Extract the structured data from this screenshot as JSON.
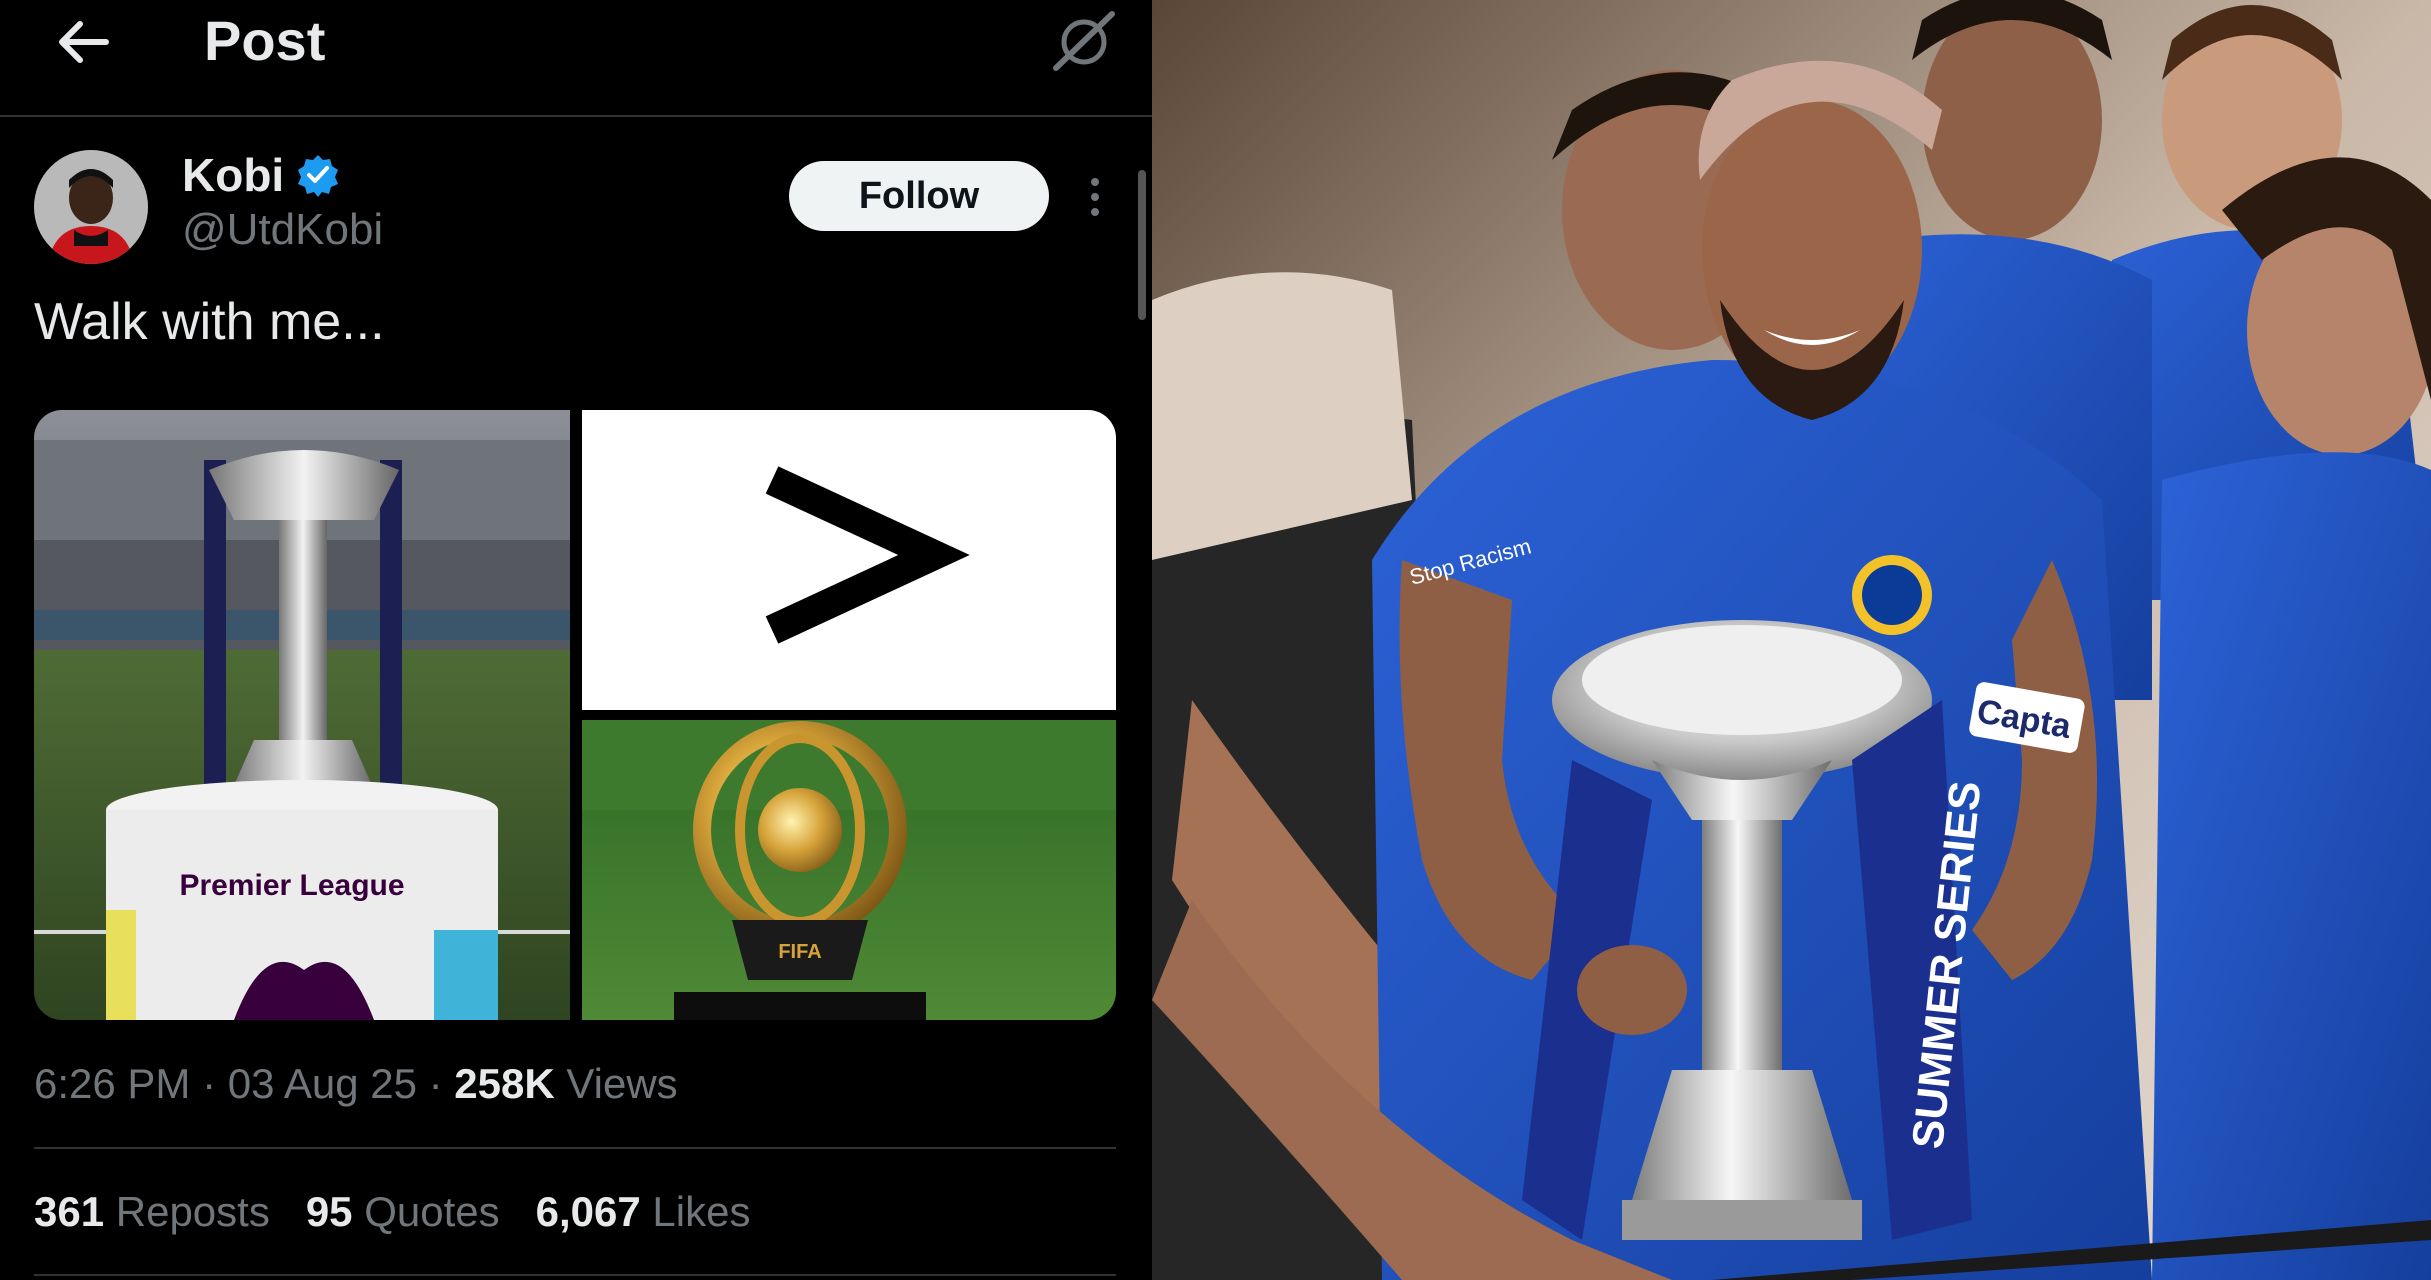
{
  "header": {
    "title": "Post"
  },
  "author": {
    "name": "Kobi",
    "handle": "@UtdKobi",
    "follow_label": "Follow"
  },
  "tweet": {
    "text": "Walk with me..."
  },
  "media": {
    "trophy_stand_text": "Premier League",
    "ribbon_text": "SUMMER SERIES",
    "comparison_symbol": ">",
    "fifa_base_text": "FIFA"
  },
  "meta": {
    "time": "6:26 PM",
    "date": "03 Aug 25",
    "views_count": "258K",
    "views_label": "Views",
    "sep": "·"
  },
  "stats": {
    "reposts_count": "361",
    "reposts_label": "Reposts",
    "quotes_count": "95",
    "quotes_label": "Quotes",
    "likes_count": "6,067",
    "likes_label": "Likes"
  },
  "photo": {
    "armband_text": "Capta",
    "sponsor_text": "Stop Racism",
    "ribbon_text": "SUMMER SERIES"
  },
  "icons": [
    "back-arrow-icon",
    "grok-icon",
    "verified-badge-icon",
    "more-options-icon"
  ],
  "colors": {
    "background": "#000000",
    "text": "#e7e9ea",
    "muted": "#71767b",
    "verified": "#1d9bf0",
    "follow_bg": "#eff3f4",
    "chelsea_blue": "#1f4fc1"
  }
}
